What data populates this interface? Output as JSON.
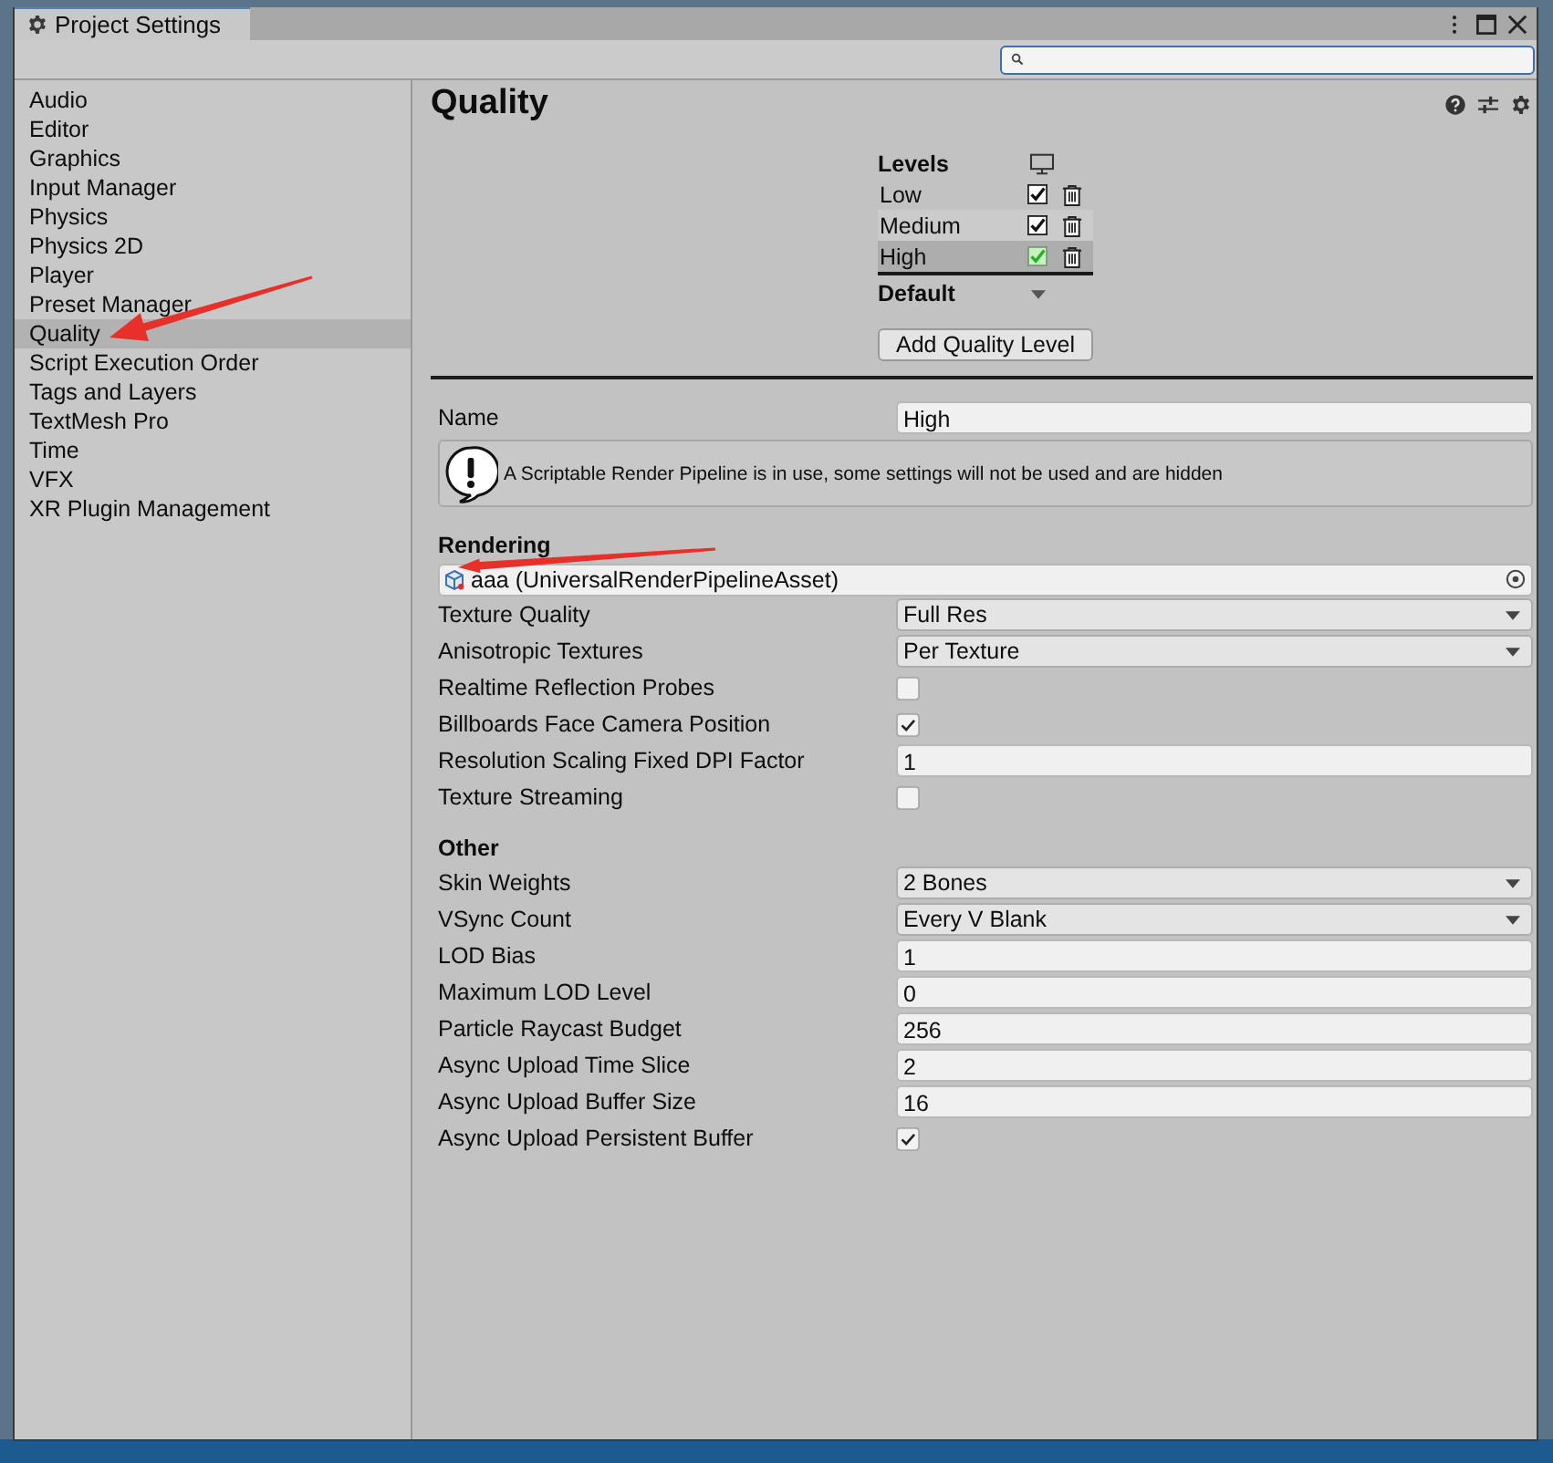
{
  "window": {
    "title": "Project Settings"
  },
  "sidebar": {
    "items": [
      {
        "label": "Audio",
        "selected": false
      },
      {
        "label": "Editor",
        "selected": false
      },
      {
        "label": "Graphics",
        "selected": false
      },
      {
        "label": "Input Manager",
        "selected": false
      },
      {
        "label": "Physics",
        "selected": false
      },
      {
        "label": "Physics 2D",
        "selected": false
      },
      {
        "label": "Player",
        "selected": false
      },
      {
        "label": "Preset Manager",
        "selected": false
      },
      {
        "label": "Quality",
        "selected": true
      },
      {
        "label": "Script Execution Order",
        "selected": false
      },
      {
        "label": "Tags and Layers",
        "selected": false
      },
      {
        "label": "TextMesh Pro",
        "selected": false
      },
      {
        "label": "Time",
        "selected": false
      },
      {
        "label": "VFX",
        "selected": false
      },
      {
        "label": "XR Plugin Management",
        "selected": false
      }
    ]
  },
  "page": {
    "title": "Quality"
  },
  "levels": {
    "heading": "Levels",
    "rows": [
      {
        "name": "Low",
        "checked": true,
        "default": false,
        "selected": false
      },
      {
        "name": "Medium",
        "checked": true,
        "default": false,
        "selected": false
      },
      {
        "name": "High",
        "checked": true,
        "default": true,
        "selected": true
      }
    ],
    "default_label": "Default",
    "add_button": "Add Quality Level"
  },
  "name_field": {
    "label": "Name",
    "value": "High"
  },
  "help_box": {
    "text": "A Scriptable Render Pipeline is in use, some settings will not be used and are hidden"
  },
  "sections": [
    {
      "heading": "Rendering",
      "fields": [
        {
          "kind": "object",
          "value": "aaa (UniversalRenderPipelineAsset)"
        },
        {
          "kind": "dropdown",
          "label": "Texture Quality",
          "value": "Full Res"
        },
        {
          "kind": "dropdown",
          "label": "Anisotropic Textures",
          "value": "Per Texture"
        },
        {
          "kind": "checkbox",
          "label": "Realtime Reflection Probes",
          "checked": false
        },
        {
          "kind": "checkbox",
          "label": "Billboards Face Camera Position",
          "checked": true
        },
        {
          "kind": "text",
          "label": "Resolution Scaling Fixed DPI Factor",
          "value": "1"
        },
        {
          "kind": "checkbox",
          "label": "Texture Streaming",
          "checked": false
        }
      ]
    },
    {
      "heading": "Other",
      "fields": [
        {
          "kind": "dropdown",
          "label": "Skin Weights",
          "value": "2 Bones"
        },
        {
          "kind": "dropdown",
          "label": "VSync Count",
          "value": "Every V Blank"
        },
        {
          "kind": "text",
          "label": "LOD Bias",
          "value": "1"
        },
        {
          "kind": "text",
          "label": "Maximum LOD Level",
          "value": "0"
        },
        {
          "kind": "text",
          "label": "Particle Raycast Budget",
          "value": "256"
        },
        {
          "kind": "text",
          "label": "Async Upload Time Slice",
          "value": "2"
        },
        {
          "kind": "text",
          "label": "Async Upload Buffer Size",
          "value": "16"
        },
        {
          "kind": "checkbox",
          "label": "Async Upload Persistent Buffer",
          "checked": true
        }
      ]
    }
  ]
}
